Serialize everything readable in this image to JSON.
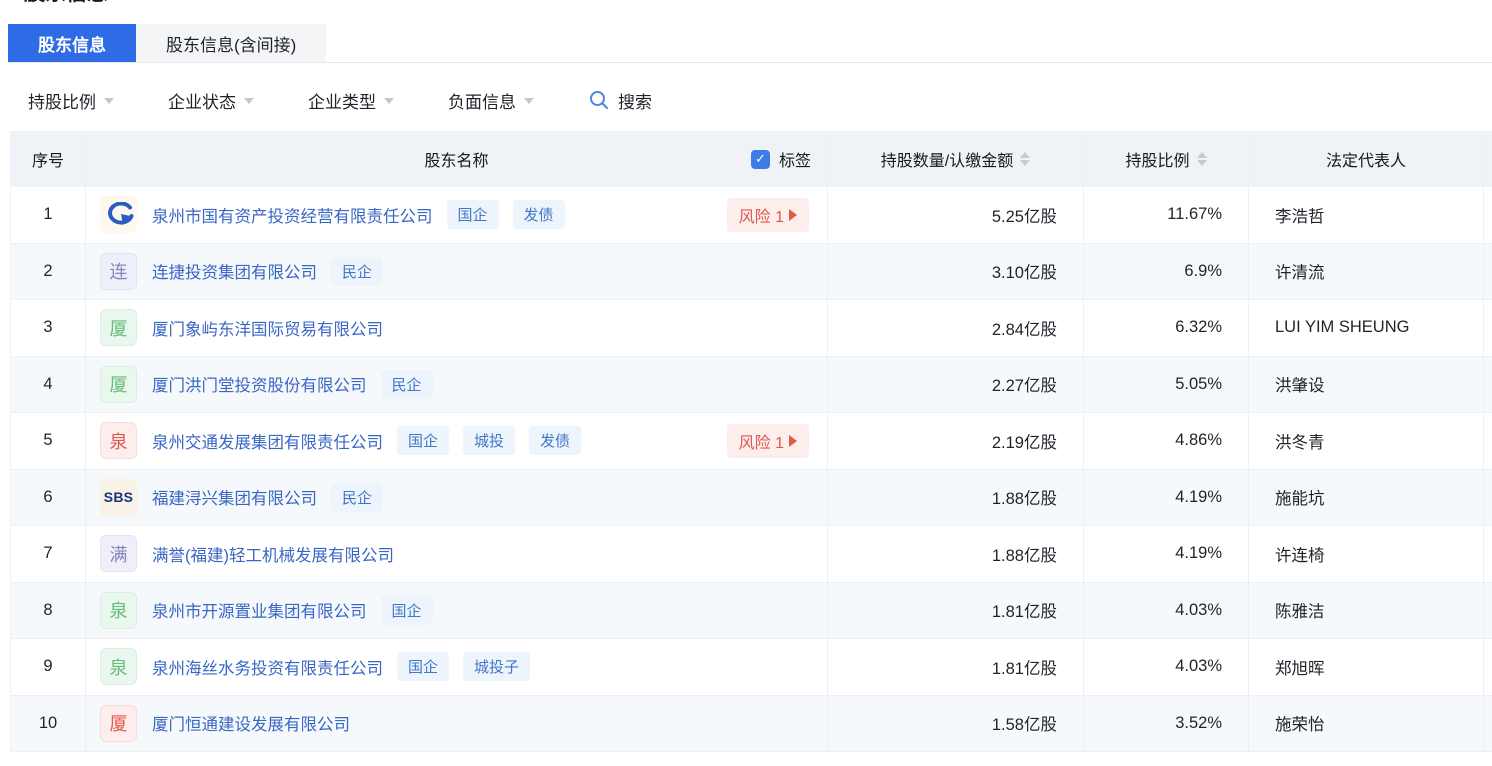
{
  "page_title": "股东信息",
  "tabs": [
    {
      "label": "股东信息",
      "active": true
    },
    {
      "label": "股东信息(含间接)",
      "active": false
    }
  ],
  "filters": [
    {
      "label": "持股比例"
    },
    {
      "label": "企业状态"
    },
    {
      "label": "企业类型"
    },
    {
      "label": "负面信息"
    }
  ],
  "search": {
    "label": "搜索"
  },
  "colors": {
    "accent_blue": "#2F6BE4",
    "link_blue": "#3A66C4",
    "tag_blue": "#4077C8",
    "tag_bg": "#EEF4FB",
    "risk_red": "#E2574C",
    "risk_bg": "#FCEEEC"
  },
  "table": {
    "headers": {
      "index": "序号",
      "name": "股东名称",
      "tag_checkbox_label": "标签",
      "amount": "持股数量/认缴金额",
      "ratio": "持股比例",
      "legal_rep": "法定代表人"
    },
    "rows": [
      {
        "index": "1",
        "avatar": {
          "kind": "logo",
          "name": "g-arrow-logo"
        },
        "name": "泉州市国有资产投资经营有限责任公司",
        "tags": [
          "国企",
          "发债"
        ],
        "risk": "风险 1",
        "amount": "5.25亿股",
        "ratio": "11.67%",
        "legal_rep": "李浩哲"
      },
      {
        "index": "2",
        "avatar": {
          "kind": "text",
          "text": "连",
          "color": "purple"
        },
        "name": "连捷投资集团有限公司",
        "tags": [
          "民企"
        ],
        "risk": null,
        "amount": "3.10亿股",
        "ratio": "6.9%",
        "legal_rep": "许清流"
      },
      {
        "index": "3",
        "avatar": {
          "kind": "text",
          "text": "厦",
          "color": "green"
        },
        "name": "厦门象屿东洋国际贸易有限公司",
        "tags": [],
        "risk": null,
        "amount": "2.84亿股",
        "ratio": "6.32%",
        "legal_rep": "LUI YIM SHEUNG"
      },
      {
        "index": "4",
        "avatar": {
          "kind": "text",
          "text": "厦",
          "color": "green"
        },
        "name": "厦门洪门堂投资股份有限公司",
        "tags": [
          "民企"
        ],
        "risk": null,
        "amount": "2.27亿股",
        "ratio": "5.05%",
        "legal_rep": "洪肇设"
      },
      {
        "index": "5",
        "avatar": {
          "kind": "text",
          "text": "泉",
          "color": "red"
        },
        "name": "泉州交通发展集团有限责任公司",
        "tags": [
          "国企",
          "城投",
          "发债"
        ],
        "risk": "风险 1",
        "amount": "2.19亿股",
        "ratio": "4.86%",
        "legal_rep": "洪冬青"
      },
      {
        "index": "6",
        "avatar": {
          "kind": "text",
          "text": "SBS",
          "color": "sbs"
        },
        "name": "福建浔兴集团有限公司",
        "tags": [
          "民企"
        ],
        "risk": null,
        "amount": "1.88亿股",
        "ratio": "4.19%",
        "legal_rep": "施能坑"
      },
      {
        "index": "7",
        "avatar": {
          "kind": "text",
          "text": "满",
          "color": "purple"
        },
        "name": "满誉(福建)轻工机械发展有限公司",
        "tags": [],
        "risk": null,
        "amount": "1.88亿股",
        "ratio": "4.19%",
        "legal_rep": "许连椅"
      },
      {
        "index": "8",
        "avatar": {
          "kind": "text",
          "text": "泉",
          "color": "green"
        },
        "name": "泉州市开源置业集团有限公司",
        "tags": [
          "国企"
        ],
        "risk": null,
        "amount": "1.81亿股",
        "ratio": "4.03%",
        "legal_rep": "陈雅洁"
      },
      {
        "index": "9",
        "avatar": {
          "kind": "text",
          "text": "泉",
          "color": "green"
        },
        "name": "泉州海丝水务投资有限责任公司",
        "tags": [
          "国企",
          "城投子"
        ],
        "risk": null,
        "amount": "1.81亿股",
        "ratio": "4.03%",
        "legal_rep": "郑旭晖"
      },
      {
        "index": "10",
        "avatar": {
          "kind": "text",
          "text": "厦",
          "color": "red"
        },
        "name": "厦门恒通建设发展有限公司",
        "tags": [],
        "risk": null,
        "amount": "1.58亿股",
        "ratio": "3.52%",
        "legal_rep": "施荣怡"
      }
    ]
  }
}
